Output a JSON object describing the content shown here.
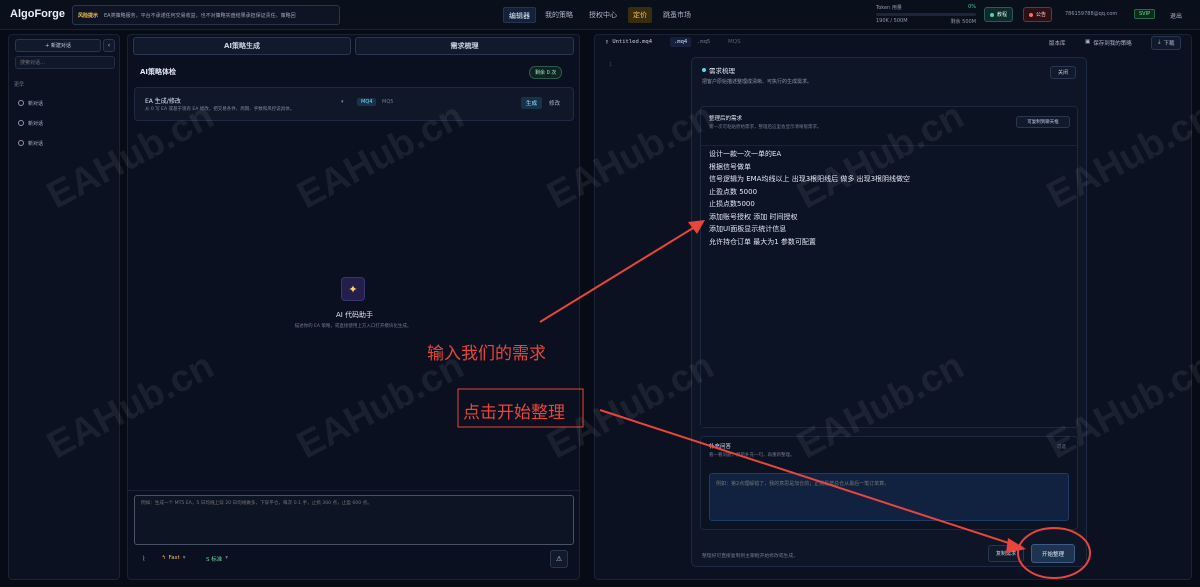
{
  "header": {
    "logo": "AlgoForge",
    "notice_tag": "风险提示",
    "notice_text": "EA类策略服务，平台不承诺任何交易收益，也不对策略实盘结果承担保证责任。策略回",
    "nav": [
      "编辑器",
      "我的策略",
      "授权中心",
      "定价",
      "跳蚤市场"
    ],
    "token_label": "Token 用量",
    "token_percent": "0%",
    "token_used": "190K / 500M",
    "token_left": "剩余 500M",
    "tutorial": "教程",
    "bulletin": "公告",
    "email": "786159788@qq.com",
    "vip": "SVIP",
    "logout": "退出"
  },
  "sidebar": {
    "new_chat": "+ 新建对话",
    "search_placeholder": "搜索对话…",
    "group": "更早",
    "items": [
      "新对话",
      "新对话",
      "新对话"
    ]
  },
  "middle": {
    "tabs": [
      "AI策略生成",
      "需求梳理"
    ],
    "section_title": "AI策略体检",
    "remaining": "剩余 0 次",
    "card_title": "EA 生成/修改",
    "card_desc": "从 0 写 EA 或基于现有 EA 修改，把交易条件、周期、手数和风控说具体。",
    "lang_mq4": "MQ4",
    "lang_mq5": "MQ5",
    "generate": "生成",
    "modify": "修改",
    "assistant_title": "AI 代码助手",
    "assistant_desc": "描述你的 EA 策略，或直接使用上方入口打开模块化生成。",
    "input_placeholder": "例如：生成一个 MT5 EA，5 日均线上穿 20 日均线做多，下穿平仓，每次 0.1 手，止损 300 点，止盈 600 点。",
    "model_fast": "Fast",
    "model_std": "S 标准"
  },
  "right": {
    "file_tab": "Untitled.mq4",
    "ext_mq4": ".mq4",
    "ext_mq5": ".mq5",
    "ext_mqs": "MQS",
    "version_label": "版本库",
    "save_label": "保存到我的策略",
    "download_label": "下载",
    "panel_title": "需求梳理",
    "panel_desc": "把客户原始描述整理成清晰、可执行的生成需求。",
    "close": "关闭",
    "organized_title": "整理后的需求",
    "organized_desc": "第一次可粘贴原始需求，整理后这里会显示清晰版需求。",
    "copy_gen": "可复制到聊天框",
    "requirement_lines": [
      "设计一款一次一单的EA",
      "根据信号做单",
      "信号逻辑为  EMA均线以上  出现3根阳线后  做多   出现3根阴线做空",
      "止盈点数 5000",
      "止损点数5000",
      "添加账号授权 添加 时间授权",
      "添加UI面板显示统计信息",
      "允许持仓订单 最大为1   参数可配置"
    ],
    "supp_title": "补充问答",
    "supp_desc": "看一看问题，然后补充一句，再重新整理。",
    "supp_right": "可选",
    "supp_placeholder": "例如：第2点理解错了，我的意思是加仓前；止损是按总仓从最后一笔订单算。",
    "footer_note": "整理好可直接复制到主聊框开始修改或生成。",
    "copy_btn": "复制需求",
    "start_btn": "开始整理"
  },
  "annotations": {
    "input_label": "输入我们的需求",
    "click_label": "点击开始整理",
    "accent": "#e8453c"
  },
  "watermark": "EAHub.cn"
}
